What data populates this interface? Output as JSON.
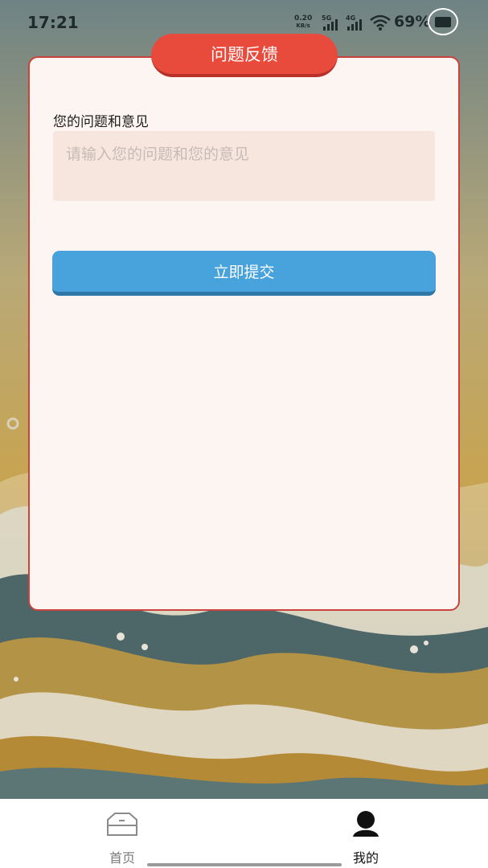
{
  "status_bar": {
    "time": "17:21",
    "net_speed_value": "0.20",
    "net_speed_unit": "KB/s",
    "sim1_label": "5G",
    "sim2_label": "4G",
    "battery": "69%"
  },
  "page": {
    "title": "问题反馈",
    "field_label": "您的问题和意见",
    "field_placeholder": "请输入您的问题和您的意见",
    "field_value": "",
    "submit_label": "立即提交"
  },
  "tabbar": {
    "items": [
      {
        "label": "首页",
        "icon": "home-icon",
        "active": false
      },
      {
        "label": "我的",
        "icon": "profile-icon",
        "active": true
      }
    ]
  },
  "colors": {
    "accent_red": "#e84a3c",
    "button_blue": "#48a3dc",
    "card_bg": "#fdf5f1"
  }
}
